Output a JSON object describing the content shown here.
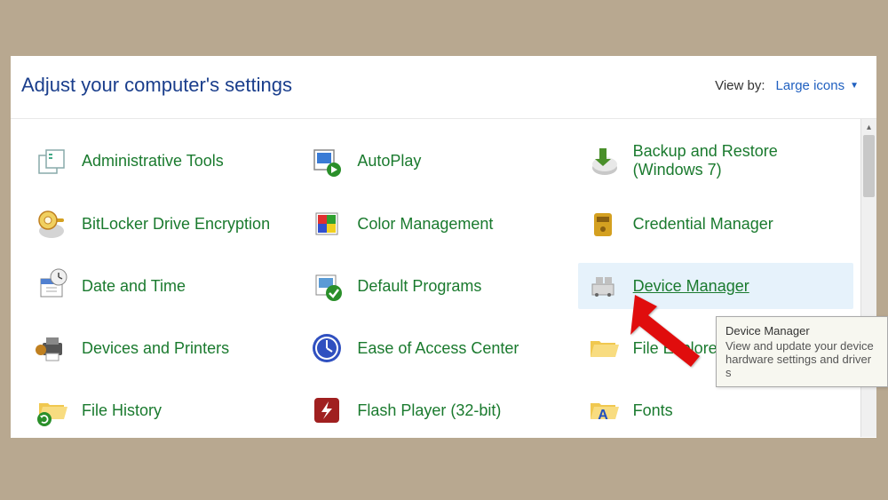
{
  "header": {
    "title": "Adjust your computer's settings",
    "view_by_label": "View by:",
    "view_by_value": "Large icons"
  },
  "items": [
    {
      "label": "Administrative Tools",
      "icon": "admin-tools",
      "selected": false
    },
    {
      "label": "AutoPlay",
      "icon": "autoplay",
      "selected": false
    },
    {
      "label": "Backup and Restore (Windows 7)",
      "icon": "backup",
      "selected": false
    },
    {
      "label": "BitLocker Drive Encryption",
      "icon": "bitlocker",
      "selected": false
    },
    {
      "label": "Color Management",
      "icon": "color",
      "selected": false
    },
    {
      "label": "Credential Manager",
      "icon": "credential",
      "selected": false
    },
    {
      "label": "Date and Time",
      "icon": "date",
      "selected": false
    },
    {
      "label": "Default Programs",
      "icon": "default-programs",
      "selected": false
    },
    {
      "label": "Device Manager",
      "icon": "device-manager",
      "selected": true
    },
    {
      "label": "Devices and Printers",
      "icon": "devices-printers",
      "selected": false
    },
    {
      "label": "Ease of Access Center",
      "icon": "ease",
      "selected": false
    },
    {
      "label": "File Explorer Options",
      "icon": "fileexplorer",
      "selected": false
    },
    {
      "label": "File History",
      "icon": "filehistory",
      "selected": false
    },
    {
      "label": "Flash Player (32-bit)",
      "icon": "flash",
      "selected": false
    },
    {
      "label": "Fonts",
      "icon": "fonts",
      "selected": false
    }
  ],
  "tooltip": {
    "title": "Device Manager",
    "body": "View and update your device hardware settings and driver s"
  }
}
